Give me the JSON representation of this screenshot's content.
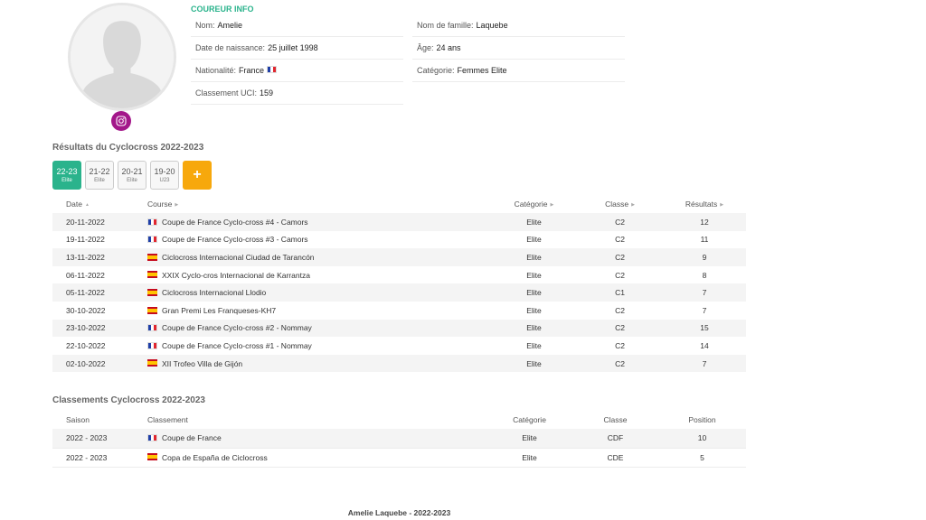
{
  "profile": {
    "section_title": "COUREUR INFO",
    "fields": [
      {
        "label": "Nom:",
        "value": "Amelie",
        "flag": ""
      },
      {
        "label": "Nom de famille:",
        "value": "Laquebe",
        "flag": ""
      },
      {
        "label": "Date de naissance:",
        "value": "25 juillet 1998",
        "flag": ""
      },
      {
        "label": "Âge:",
        "value": "24 ans",
        "flag": ""
      },
      {
        "label": "Nationalité:",
        "value": "France",
        "flag": "fr"
      },
      {
        "label": "Catégorie:",
        "value": "Femmes Elite",
        "flag": ""
      },
      {
        "label": "Classement UCI:",
        "value": "159",
        "flag": ""
      }
    ]
  },
  "results": {
    "title": "Résultats du Cyclocross 2022-2023",
    "seasons": [
      {
        "year": "22-23",
        "category": "Elite",
        "active": true
      },
      {
        "year": "21-22",
        "category": "Elite",
        "active": false
      },
      {
        "year": "20-21",
        "category": "Elite",
        "active": false
      },
      {
        "year": "19-20",
        "category": "U23",
        "active": false
      }
    ],
    "add_label": "+",
    "columns": [
      "Date",
      "Course",
      "Catégorie",
      "Classe",
      "Résultats"
    ],
    "rows": [
      {
        "date": "20-11-2022",
        "flag": "fr",
        "course": "Coupe de France Cyclo-cross #4 - Camors",
        "category": "Elite",
        "class": "C2",
        "result": "12"
      },
      {
        "date": "19-11-2022",
        "flag": "fr",
        "course": "Coupe de France Cyclo-cross #3 - Camors",
        "category": "Elite",
        "class": "C2",
        "result": "11"
      },
      {
        "date": "13-11-2022",
        "flag": "es",
        "course": "Ciclocross Internacional Ciudad de Tarancón",
        "category": "Elite",
        "class": "C2",
        "result": "9"
      },
      {
        "date": "06-11-2022",
        "flag": "es",
        "course": "XXIX Cyclo-cros Internacional de Karrantza",
        "category": "Elite",
        "class": "C2",
        "result": "8"
      },
      {
        "date": "05-11-2022",
        "flag": "es",
        "course": "Ciclocross Internacional Llodio",
        "category": "Elite",
        "class": "C1",
        "result": "7"
      },
      {
        "date": "30-10-2022",
        "flag": "es",
        "course": "Gran Premi Les Franqueses-KH7",
        "category": "Elite",
        "class": "C2",
        "result": "7"
      },
      {
        "date": "23-10-2022",
        "flag": "fr",
        "course": "Coupe de France Cyclo-cross #2 - Nommay",
        "category": "Elite",
        "class": "C2",
        "result": "15"
      },
      {
        "date": "22-10-2022",
        "flag": "fr",
        "course": "Coupe de France Cyclo-cross #1 - Nommay",
        "category": "Elite",
        "class": "C2",
        "result": "14"
      },
      {
        "date": "02-10-2022",
        "flag": "es",
        "course": "XII Trofeo Villa de Gijón",
        "category": "Elite",
        "class": "C2",
        "result": "7"
      }
    ]
  },
  "standings": {
    "title": "Classements Cyclocross 2022-2023",
    "columns": [
      "Saison",
      "Classement",
      "Catégorie",
      "Classe",
      "Position"
    ],
    "rows": [
      {
        "season": "2022 - 2023",
        "flag": "fr",
        "ranking": "Coupe de France",
        "category": "Elite",
        "class": "CDF",
        "position": "10"
      },
      {
        "season": "2022 - 2023",
        "flag": "es",
        "ranking": "Copa de España de Ciclocross",
        "category": "Elite",
        "class": "CDE",
        "position": "5"
      }
    ]
  },
  "footer": "Amelie Laquebe - 2022-2023",
  "colors": {
    "accent": "#2ab38c",
    "add_button": "#f7a80c",
    "instagram": "#a3178a"
  }
}
